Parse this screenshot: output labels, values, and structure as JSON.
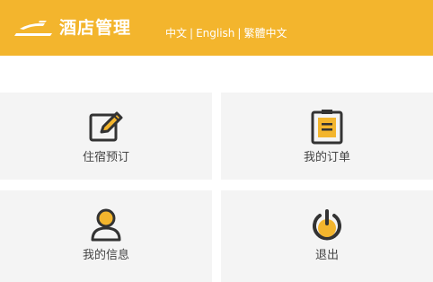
{
  "header": {
    "title": "酒店管理",
    "languages": [
      "中文",
      "English",
      "繁體中文"
    ],
    "background": "#f3b52d"
  },
  "menu": [
    {
      "label": "住宿预订",
      "icon": "edit-icon"
    },
    {
      "label": "我的订单",
      "icon": "clipboard-icon"
    },
    {
      "label": "我的信息",
      "icon": "user-icon"
    },
    {
      "label": "退出",
      "icon": "power-icon"
    }
  ],
  "colors": {
    "accent": "#f3b52d",
    "icon_stroke": "#333333"
  }
}
